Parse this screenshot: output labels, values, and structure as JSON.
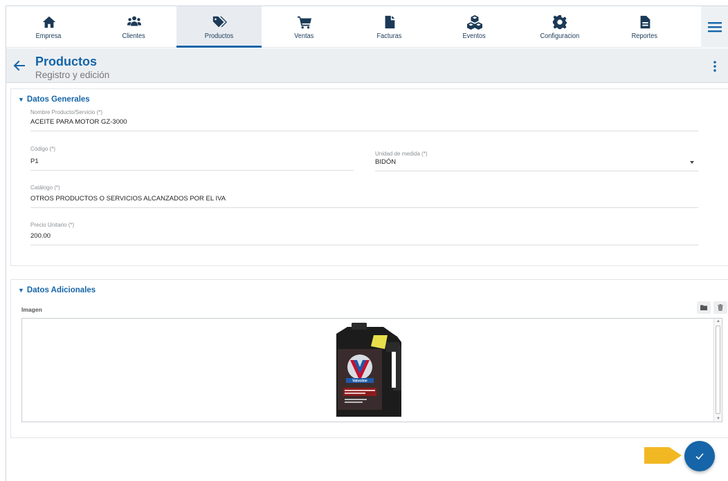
{
  "nav": {
    "items": [
      {
        "label": "Empresa",
        "icon": "home-icon"
      },
      {
        "label": "Clientes",
        "icon": "users-icon"
      },
      {
        "label": "Productos",
        "icon": "tags-icon",
        "active": true
      },
      {
        "label": "Ventas",
        "icon": "cart-icon"
      },
      {
        "label": "Facturas",
        "icon": "file-icon"
      },
      {
        "label": "Eventos",
        "icon": "cubes-icon"
      },
      {
        "label": "Configuracion",
        "icon": "gear-icon"
      },
      {
        "label": "Reportes",
        "icon": "report-icon"
      }
    ],
    "menu_icon": "hamburger-icon"
  },
  "header": {
    "title": "Productos",
    "subtitle": "Registro y edición"
  },
  "general": {
    "section_title": "Datos Generales",
    "nombre": {
      "label": "Nombre Producto/Servicio (*)",
      "value": "ACEITE PARA MOTOR GZ-3000"
    },
    "codigo": {
      "label": "Código (*)",
      "value": "P1"
    },
    "unidad": {
      "label": "Unidad de medida (*)",
      "value": "BIDÓN"
    },
    "catalogo": {
      "label": "Catálogo (*)",
      "value": "OTROS PRODUCTOS O SERVICIOS ALCANZADOS POR EL IVA"
    },
    "precio": {
      "label": "Precio Unitario (*)",
      "value": "200.00"
    }
  },
  "adicional": {
    "section_title": "Datos Adicionales",
    "image_label": "Imagen",
    "image_brand": "Valvoline"
  },
  "colors": {
    "primary": "#1565a8",
    "nav_icon": "#1b3a57",
    "fab_arrow": "#f2b824"
  }
}
